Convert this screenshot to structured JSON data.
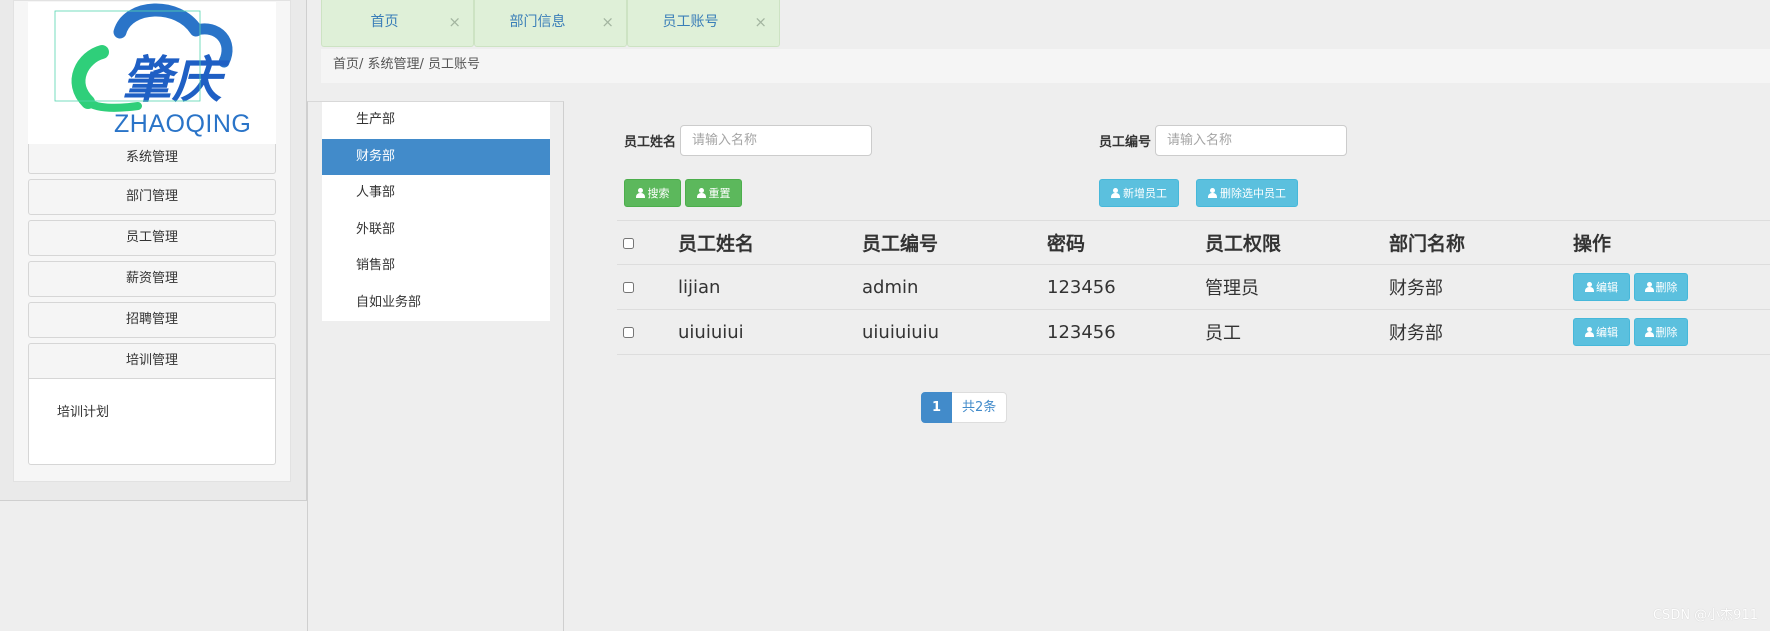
{
  "logo": {
    "title_chars": "肇庆",
    "subtitle": "ZHAOQING"
  },
  "sidebar": {
    "items": [
      {
        "label": "系统管理"
      },
      {
        "label": "部门管理"
      },
      {
        "label": "员工管理"
      },
      {
        "label": "薪资管理"
      },
      {
        "label": "招聘管理"
      },
      {
        "label": "培训管理"
      }
    ],
    "submenu": {
      "label": "培训计划"
    }
  },
  "tabs": [
    {
      "label": "首页",
      "close": "×"
    },
    {
      "label": "部门信息",
      "close": "×"
    },
    {
      "label": "员工账号",
      "close": "×"
    }
  ],
  "breadcrumb": "首页/ 系统管理/ 员工账号",
  "departments": [
    {
      "label": "生产部"
    },
    {
      "label": "财务部"
    },
    {
      "label": "人事部"
    },
    {
      "label": "外联部"
    },
    {
      "label": "销售部"
    },
    {
      "label": "自如业务部"
    }
  ],
  "search": {
    "name_label": "员工姓名",
    "name_placeholder": "请输入名称",
    "number_label": "员工编号",
    "number_placeholder": "请输入名称",
    "search_btn": "搜索",
    "reset_btn": "重置",
    "add_btn": "新增员工",
    "delete_selected_btn": "删除选中员工"
  },
  "table": {
    "headers": [
      "员工姓名",
      "员工编号",
      "密码",
      "员工权限",
      "部门名称",
      "操作"
    ],
    "rows": [
      {
        "name": "lijian",
        "number": "admin",
        "password": "123456",
        "role": "管理员",
        "dept": "财务部"
      },
      {
        "name": "uiuiuiui",
        "number": "uiuiuiuiu",
        "password": "123456",
        "role": "员工",
        "dept": "财务部"
      }
    ],
    "edit_label": "编辑",
    "delete_label": "删除"
  },
  "pagination": {
    "current": "1",
    "total": "共2条"
  },
  "watermark": "CSDN @小杰911",
  "colors": {
    "primary": "#428bca",
    "success": "#5cb85c",
    "info": "#5bc0de",
    "tab_bg": "#dff0d8"
  }
}
